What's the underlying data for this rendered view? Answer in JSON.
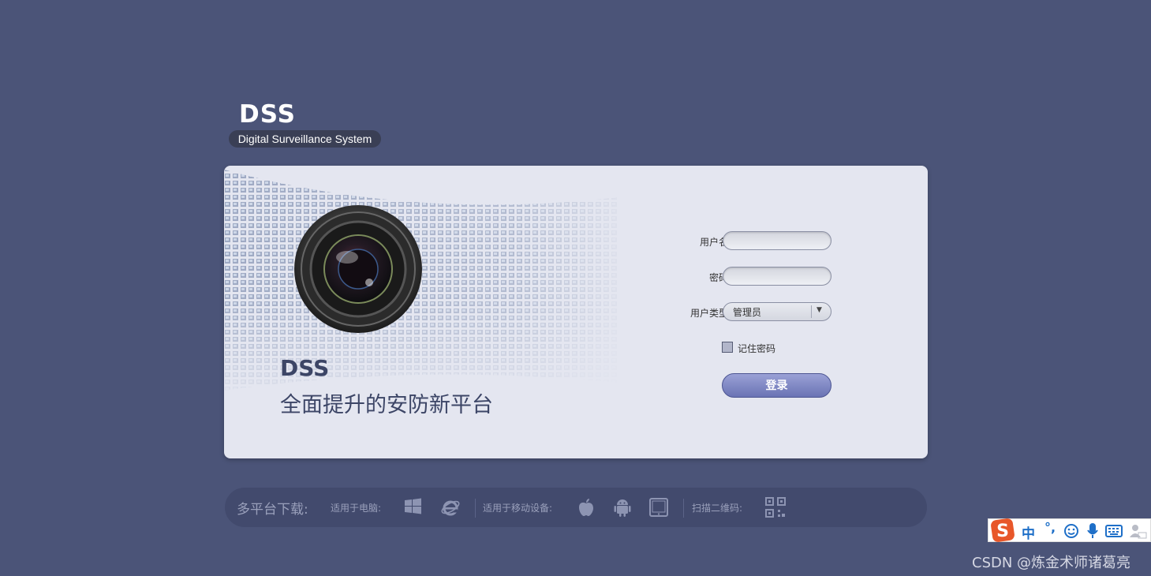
{
  "logo": {
    "title": "DSS",
    "subtitle": "Digital Surveillance System"
  },
  "hero": {
    "title": "DSS",
    "subtitle": "全面提升的安防新平台"
  },
  "form": {
    "username_label": "用户名",
    "username_value": "",
    "password_label": "密码",
    "password_value": "",
    "user_type_label": "用户类型",
    "user_type_selected": "管理员",
    "remember_label": "记住密码",
    "remember_checked": false,
    "login_button": "登录"
  },
  "downloads": {
    "title": "多平台下载:",
    "pc_label": "适用于电脑:",
    "pc_icons": [
      "windows-icon",
      "ie-icon"
    ],
    "mobile_label": "适用于移动设备:",
    "mobile_icons": [
      "apple-icon",
      "android-icon",
      "tablet-icon"
    ],
    "qr_label": "扫描二维码:",
    "qr_icons": [
      "qr-code-icon"
    ]
  },
  "ime": {
    "mode": "中",
    "punct": "°,"
  },
  "watermark": "CSDN @炼金术师诸葛亮",
  "colors": {
    "background": "#4b5478",
    "button": "#7a82c2",
    "card": "#e4e6f0"
  }
}
